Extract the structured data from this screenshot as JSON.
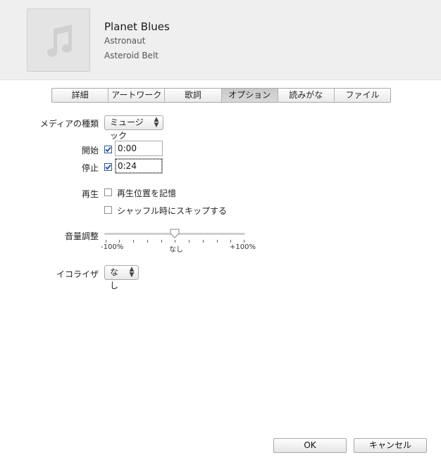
{
  "track": {
    "title": "Planet Blues",
    "artist": "Astronaut",
    "album": "Asteroid Belt",
    "artwork_icon": "music-note-icon"
  },
  "tabs": [
    {
      "label": "詳細",
      "active": false
    },
    {
      "label": "アートワーク",
      "active": false
    },
    {
      "label": "歌詞",
      "active": false
    },
    {
      "label": "オプション",
      "active": true
    },
    {
      "label": "読みがな",
      "active": false
    },
    {
      "label": "ファイル",
      "active": false
    }
  ],
  "options": {
    "media_kind_label": "メディアの種類",
    "media_kind_value": "ミュージック",
    "start_label": "開始",
    "start_checked": true,
    "start_value": "0:00",
    "stop_label": "停止",
    "stop_checked": true,
    "stop_value": "0:24",
    "playback_label": "再生",
    "remember_position_label": "再生位置を記憶",
    "remember_position_checked": false,
    "skip_shuffle_label": "シャッフル時にスキップする",
    "skip_shuffle_checked": false,
    "volume_label": "音量調整",
    "volume_min_label": "-100%",
    "volume_mid_label": "なし",
    "volume_max_label": "+100%",
    "volume_value_percent": 0,
    "eq_label": "イコライザ",
    "eq_value": "なし"
  },
  "buttons": {
    "ok": "OK",
    "cancel": "キャンセル"
  },
  "colors": {
    "accent_check": "#2c5a9e",
    "header_bg": "#efefef"
  }
}
